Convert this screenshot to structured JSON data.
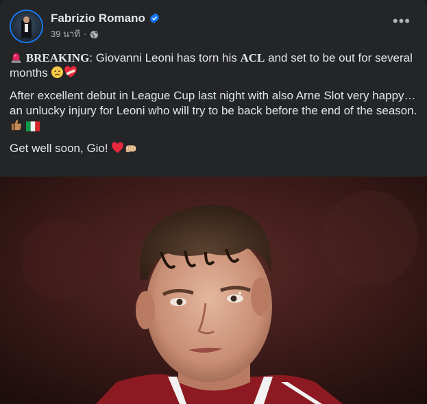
{
  "post": {
    "author": "Fabrizio Romano",
    "time": "39 นาที",
    "separator": "·",
    "more": "•••",
    "p1": {
      "label": "BREAKING",
      "colon": ": Giovanni Leoni has torn his ",
      "acl": "ACL",
      "rest": " and set to be out for several months "
    },
    "p2": "After excellent debut in League Cup last night with also Arne Slot very happy… an unlucky injury for Leoni who will try to be back before the end of the season. ",
    "p3": "Get well soon, Gio! "
  },
  "icons": [
    "siren-icon",
    "sad-face-icon",
    "mending-heart-icon",
    "thumbs-up-icon",
    "italy-flag-icon",
    "red-heart-icon",
    "fist-bump-icon",
    "verified-badge-icon",
    "globe-icon",
    "more-options-icon"
  ],
  "colors": {
    "background": "#242526",
    "text": "#e4e6eb",
    "muted": "#b0b3b8",
    "verified": "#1877f2"
  }
}
